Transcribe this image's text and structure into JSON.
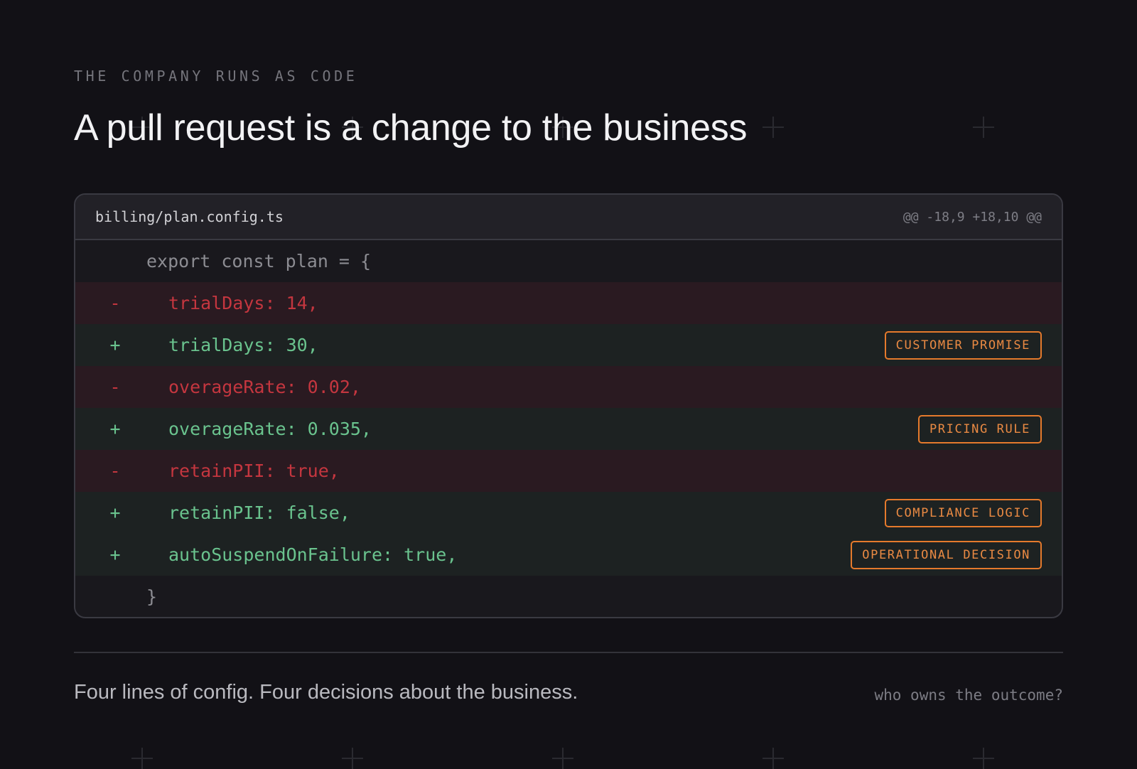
{
  "eyebrow": "THE COMPANY RUNS AS CODE",
  "title": "A pull request is a change to the business",
  "diff": {
    "filename": "billing/plan.config.ts",
    "hunk": "@@ -18,9 +18,10 @@",
    "lines": [
      {
        "type": "ctx",
        "sign": "",
        "code": "export const plan = {",
        "badge": ""
      },
      {
        "type": "del",
        "sign": "-",
        "code": "trialDays: 14,",
        "badge": ""
      },
      {
        "type": "add",
        "sign": "+",
        "code": "trialDays: 30,",
        "badge": "CUSTOMER PROMISE"
      },
      {
        "type": "del",
        "sign": "-",
        "code": "overageRate: 0.02,",
        "badge": ""
      },
      {
        "type": "add",
        "sign": "+",
        "code": "overageRate: 0.035,",
        "badge": "PRICING RULE"
      },
      {
        "type": "del",
        "sign": "-",
        "code": "retainPII: true,",
        "badge": ""
      },
      {
        "type": "add",
        "sign": "+",
        "code": "retainPII: false,",
        "badge": "COMPLIANCE LOGIC"
      },
      {
        "type": "add",
        "sign": "+",
        "code": "autoSuspendOnFailure: true,",
        "badge": "OPERATIONAL DECISION"
      },
      {
        "type": "ctx",
        "sign": "",
        "code": "}",
        "badge": ""
      }
    ]
  },
  "footer": {
    "caption": "Four lines of config. Four decisions about the business.",
    "question": "who owns the outcome?"
  },
  "colors": {
    "background": "#121116",
    "deleted_text": "#c4363f",
    "added_text": "#6ac38e",
    "badge_accent": "#e57a2c"
  }
}
